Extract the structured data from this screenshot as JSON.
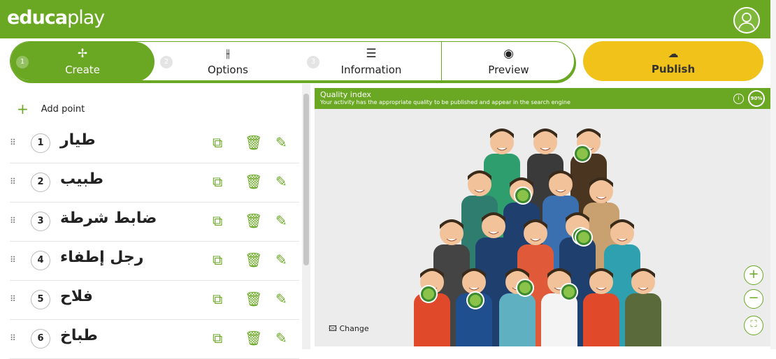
{
  "header": {
    "logo_bold": "educa",
    "logo_rest": "play",
    "avatar_icon": "user-icon"
  },
  "tabs": [
    {
      "number": "1",
      "icon": "puzzle-icon",
      "label": "Create",
      "active": true
    },
    {
      "number": "2",
      "icon": "sliders-icon",
      "label": "Options",
      "active": false
    },
    {
      "number": "3",
      "icon": "list-icon",
      "label": "Information",
      "active": false
    },
    {
      "icon": "eye-icon",
      "label": "Preview",
      "active": false
    }
  ],
  "publish": {
    "icon": "cloud-upload-icon",
    "label": "Publish",
    "color": "#f0c21a"
  },
  "points": {
    "add_label": "Add point",
    "items": [
      {
        "number": "1",
        "text": "طيار"
      },
      {
        "number": "2",
        "text": "طبيب"
      },
      {
        "number": "3",
        "text": "ضابط شرطة"
      },
      {
        "number": "4",
        "text": "رجل إطفاء"
      },
      {
        "number": "5",
        "text": "فلاح"
      },
      {
        "number": "6",
        "text": "طباخ"
      }
    ],
    "actions": [
      "copy-icon",
      "trash-icon",
      "pencil-icon"
    ]
  },
  "quality": {
    "title": "Quality index",
    "description": "Your activity has the appropriate quality to be published and appear in the search engine",
    "percent": "90%"
  },
  "image": {
    "change_label": "Change",
    "zoom_in": "+",
    "zoom_out": "−"
  },
  "colors": {
    "brand": "#6aa823",
    "publish": "#f0c21a"
  }
}
